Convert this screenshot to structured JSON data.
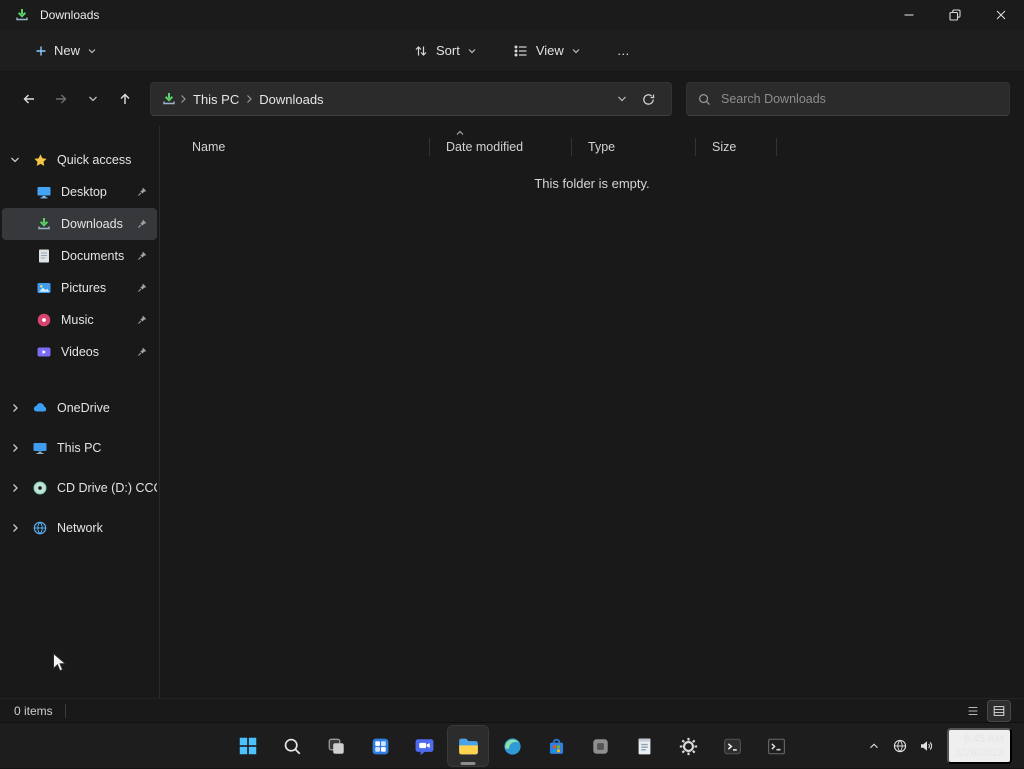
{
  "window": {
    "title": "Downloads"
  },
  "command_bar": {
    "new_label": "New",
    "sort_label": "Sort",
    "view_label": "View",
    "more_label": "…"
  },
  "navigation": {
    "breadcrumb": {
      "root": "This PC",
      "current": "Downloads"
    },
    "search_placeholder": "Search Downloads"
  },
  "sidebar": {
    "quick_access_label": "Quick access",
    "items": [
      {
        "label": "Desktop",
        "pinned": true
      },
      {
        "label": "Downloads",
        "pinned": true,
        "selected": true
      },
      {
        "label": "Documents",
        "pinned": true
      },
      {
        "label": "Pictures",
        "pinned": true
      },
      {
        "label": "Music",
        "pinned": true
      },
      {
        "label": "Videos",
        "pinned": true
      }
    ],
    "tree": [
      {
        "label": "OneDrive"
      },
      {
        "label": "This PC"
      },
      {
        "label": "CD Drive (D:) CCCO"
      },
      {
        "label": "Network"
      }
    ]
  },
  "content": {
    "columns": {
      "name": "Name",
      "date_modified": "Date modified",
      "type": "Type",
      "size": "Size"
    },
    "sorted_by": "Date modified",
    "empty_message": "This folder is empty."
  },
  "status_bar": {
    "item_count": "0 items"
  },
  "taskbar": {
    "clock": {
      "time": "8:45 AM",
      "date": "1/26/2022"
    }
  },
  "colors": {
    "accent_blue": "#4cc2ff",
    "selection_bg": "#36383b",
    "downloads_green": "#58d364",
    "folder_yellow": "#ffd34d"
  }
}
